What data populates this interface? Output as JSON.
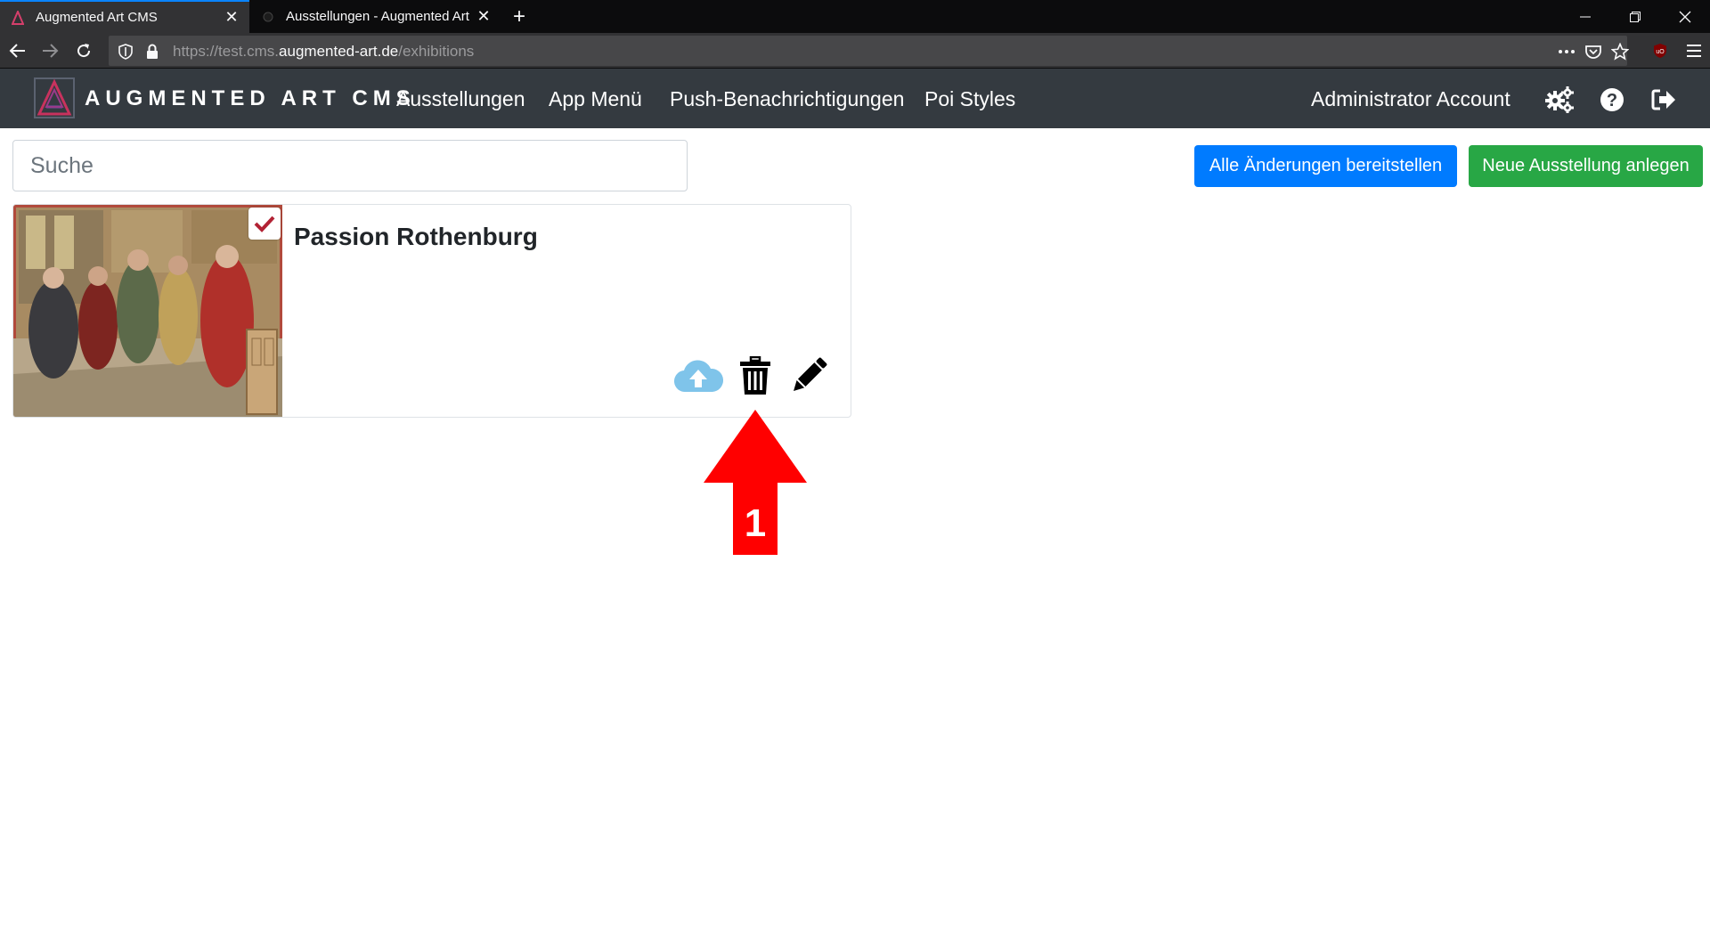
{
  "browser": {
    "tabs": [
      {
        "title": "Augmented Art CMS",
        "active": true
      },
      {
        "title": "Ausstellungen - Augmented Art",
        "active": false
      }
    ],
    "url": {
      "prefix": "https://test.cms.",
      "host": "augmented-art.de",
      "path": "/exhibitions"
    }
  },
  "app": {
    "brand": "AUGMENTED ART CMS",
    "nav": {
      "exhibitions": "Ausstellungen",
      "app_menu": "App Menü",
      "push": "Push-Benachrichtigungen",
      "poi_styles": "Poi Styles",
      "account": "Administrator Account"
    },
    "icons": [
      "settings-icon",
      "help-icon",
      "logout-icon"
    ]
  },
  "toolbar": {
    "search_placeholder": "Suche",
    "deploy_all_label": "Alle Änderungen bereitstellen",
    "new_exhibition_label": "Neue Ausstellung anlegen"
  },
  "exhibitions": [
    {
      "title": "Passion Rothenburg",
      "published": true,
      "actions": [
        "upload-cloud-icon",
        "trash-icon",
        "edit-pencil-icon"
      ]
    }
  ],
  "annotation": {
    "label": "1"
  },
  "colors": {
    "primary": "#007bff",
    "success": "#28a745",
    "navbar": "#343a40",
    "check": "#b22234",
    "cloud": "#7fc4ea",
    "annotation": "#ff0000"
  }
}
